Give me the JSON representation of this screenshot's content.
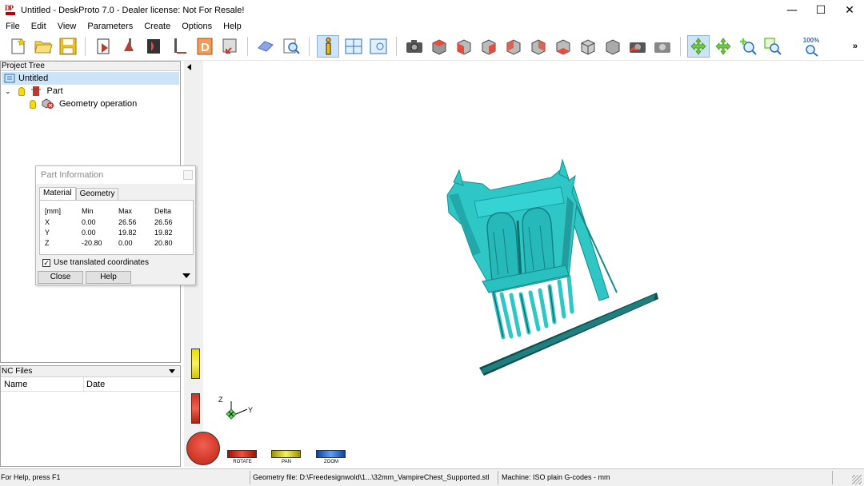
{
  "window": {
    "title": "Untitled - DeskProto 7.0 - Dealer license: Not For Resale!",
    "minimize_glyph": "—",
    "maximize_glyph": "☐",
    "close_glyph": "✕"
  },
  "menu": [
    "File",
    "Edit",
    "View",
    "Parameters",
    "Create",
    "Options",
    "Help"
  ],
  "toolbar": {
    "zoom_level": "100%",
    "more_glyph": "»",
    "accent_active": "#cfe3f7"
  },
  "project_tree": {
    "header": "Project Tree",
    "root": "Untitled",
    "part": "Part",
    "operation": "Geometry operation"
  },
  "nc_files": {
    "header": "NC Files",
    "columns": [
      "Name",
      "Date"
    ]
  },
  "part_info": {
    "title": "Part Information",
    "tabs": [
      "Material",
      "Geometry"
    ],
    "headers": [
      "[mm]",
      "Min",
      "Max",
      "Delta"
    ],
    "rows": [
      [
        "X",
        "0.00",
        "26.56",
        "26.56"
      ],
      [
        "Y",
        "0.00",
        "19.82",
        "19.82"
      ],
      [
        "Z",
        "-20.80",
        "0.00",
        "20.80"
      ]
    ],
    "checkbox_label": "Use translated coordinates",
    "checkbox_checked": true,
    "close_label": "Close",
    "help_label": "Help"
  },
  "view_controls": {
    "rotate": "ROTATE",
    "pan": "PAN",
    "zoom": "ZOOM"
  },
  "axes": {
    "z": "Z",
    "y": "Y"
  },
  "model_color": "#2fc6c6",
  "status": {
    "help": "For Help, press F1",
    "geometry_file": "Geometry file: D:\\Freedesignwold\\1...\\32mm_VampireChest_Supported.stl",
    "machine": "Machine: ISO plain G-codes - mm"
  }
}
